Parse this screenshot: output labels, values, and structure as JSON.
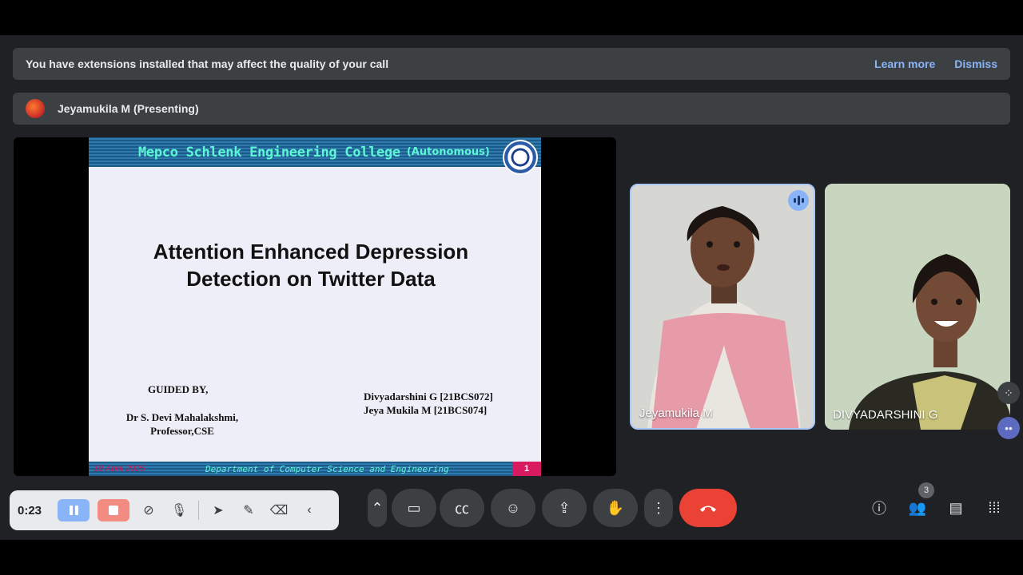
{
  "banner": {
    "message": "You have extensions installed that may affect the quality of your call",
    "learn_more": "Learn more",
    "dismiss": "Dismiss"
  },
  "presenter": {
    "label": "Jeyamukila M (Presenting)"
  },
  "slide": {
    "college": "Mepco Schlenk Engineering College",
    "autonomous": "(Autonomous)",
    "title_line1": "Attention Enhanced Depression",
    "title_line2": "Detection on Twitter Data",
    "guided_by": "GUIDED BY,",
    "guide_name": "Dr S. Devi Mahalakshmi,",
    "guide_role": "Professor,CSE",
    "student1": "Divyadarshini  G [21BCS072]",
    "student2": "Jeya Mukila M [21BCS074]",
    "footer_date": "18 April 2025",
    "footer_dept": "Department of Computer Science and Engineering",
    "page_number": "1"
  },
  "participants": [
    {
      "name": "Jeyamukila M",
      "speaking": true
    },
    {
      "name": "DIVYADARSHINI G",
      "speaking": false
    }
  ],
  "recorder": {
    "elapsed": "0:23"
  },
  "people_count": "3",
  "colors": {
    "accent_blue": "#8ab4f8",
    "end_call_red": "#ea4335",
    "background": "#202124"
  }
}
